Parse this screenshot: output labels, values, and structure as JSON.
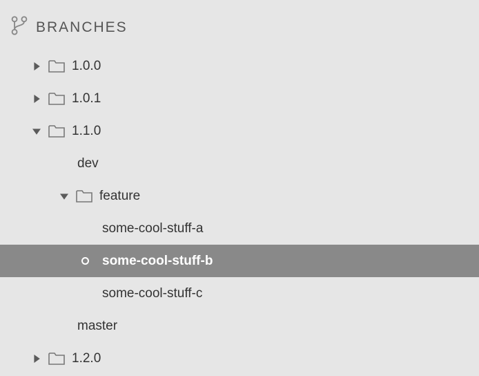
{
  "header": {
    "title": "Branches"
  },
  "items": [
    {
      "id": "v100",
      "label": "1.0.0",
      "type": "folder",
      "expanded": false,
      "depth": 1
    },
    {
      "id": "v101",
      "label": "1.0.1",
      "type": "folder",
      "expanded": false,
      "depth": 1
    },
    {
      "id": "v110",
      "label": "1.1.0",
      "type": "folder",
      "expanded": true,
      "depth": 1
    },
    {
      "id": "dev",
      "label": "dev",
      "type": "branch",
      "depth": 2
    },
    {
      "id": "feature",
      "label": "feature",
      "type": "folder",
      "expanded": true,
      "depth": 2
    },
    {
      "id": "scs-a",
      "label": "some-cool-stuff-a",
      "type": "branch",
      "depth": 3
    },
    {
      "id": "scs-b",
      "label": "some-cool-stuff-b",
      "type": "branch",
      "depth": 3,
      "selected": true,
      "current": true
    },
    {
      "id": "scs-c",
      "label": "some-cool-stuff-c",
      "type": "branch",
      "depth": 3
    },
    {
      "id": "master",
      "label": "master",
      "type": "branch",
      "depth": 2
    },
    {
      "id": "v120",
      "label": "1.2.0",
      "type": "folder",
      "expanded": false,
      "depth": 1
    }
  ]
}
